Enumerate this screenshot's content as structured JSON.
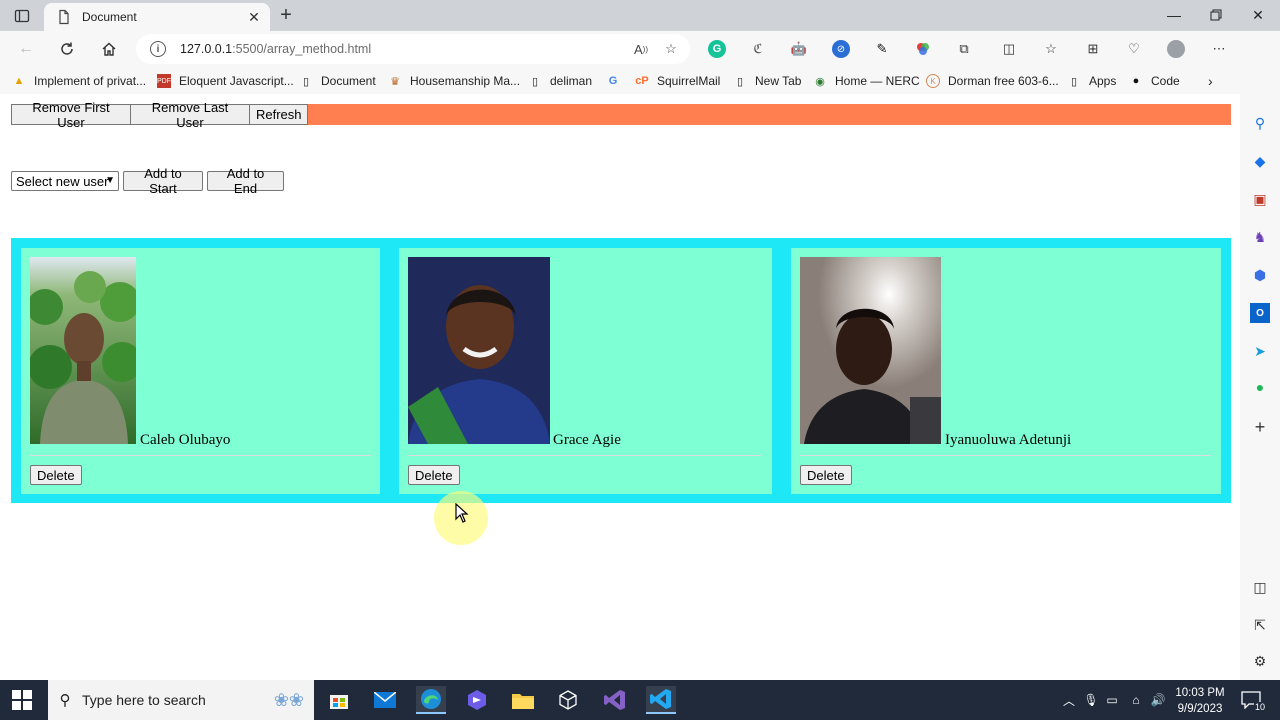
{
  "browser": {
    "tab_title": "Document",
    "new_tab_symbol": "+",
    "url_host": "127.0.0.1",
    "url_rest": ":5500/array_method.html",
    "bookmarks": [
      {
        "label": "Implement of privat...",
        "icon": "warning-icon"
      },
      {
        "label": "Eloquent Javascript...",
        "icon": "pdf-icon"
      },
      {
        "label": "Document",
        "icon": "page-icon"
      },
      {
        "label": "Housemanship Ma...",
        "icon": "site-icon"
      },
      {
        "label": "deliman",
        "icon": "page-icon"
      },
      {
        "label": "",
        "icon": "google-icon"
      },
      {
        "label": "SquirrelMail",
        "icon": "cpanel-icon"
      },
      {
        "label": "New Tab",
        "icon": "page-icon"
      },
      {
        "label": "Home — NERC",
        "icon": "site-icon"
      },
      {
        "label": "Dorman free 603-6...",
        "icon": "k-icon"
      },
      {
        "label": "Apps",
        "icon": "page-icon"
      },
      {
        "label": "Code",
        "icon": "github-icon"
      }
    ]
  },
  "page": {
    "top_buttons": {
      "remove_first": "Remove First User",
      "remove_last": "Remove Last User",
      "refresh": "Refresh"
    },
    "add_controls": {
      "select_value": "Select new user",
      "add_start": "Add to Start",
      "add_end": "Add to End"
    },
    "users": [
      {
        "name": "Caleb Olubayo",
        "delete_label": "Delete"
      },
      {
        "name": "Grace Agie",
        "delete_label": "Delete"
      },
      {
        "name": "Iyanuoluwa Adetunji",
        "delete_label": "Delete"
      }
    ],
    "colors": {
      "control_bar": "#ff7f50",
      "cards_container": "#1ee8f5",
      "card": "#7fffd4"
    }
  },
  "taskbar": {
    "search_placeholder": "Type here to search",
    "time": "10:03 PM",
    "date": "9/9/2023",
    "notification_count": "10"
  }
}
